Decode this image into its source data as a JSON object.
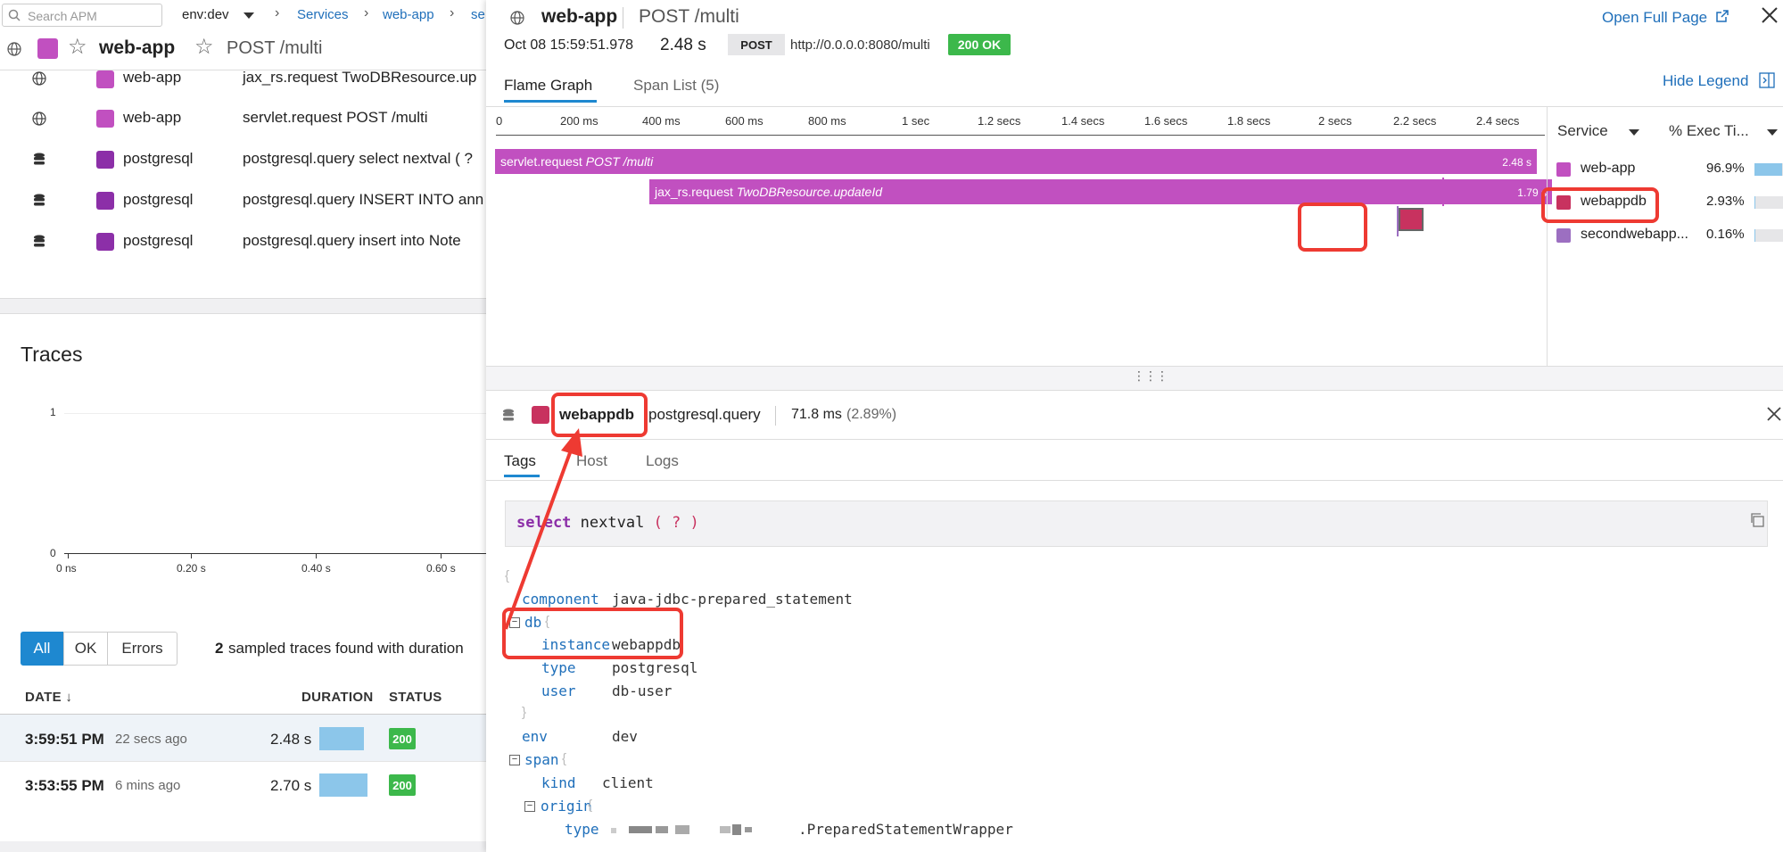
{
  "left": {
    "search_placeholder": "Search APM",
    "env": "env:dev",
    "breadcrumb": [
      "Services",
      "web-app",
      "se"
    ],
    "header": {
      "service": "web-app",
      "resource": "POST /multi"
    },
    "span_rows": [
      {
        "service": "web-app",
        "resource": "jax_rs.request TwoDBResource.up",
        "icon": "globe-icon",
        "color": "#c150c0"
      },
      {
        "service": "web-app",
        "resource": "servlet.request POST /multi",
        "icon": "globe-icon",
        "color": "#c150c0"
      },
      {
        "service": "postgresql",
        "resource": "postgresql.query select nextval ( ?",
        "icon": "database-icon",
        "color": "#8c2fa8"
      },
      {
        "service": "postgresql",
        "resource": "postgresql.query INSERT INTO ann",
        "icon": "database-icon",
        "color": "#8c2fa8"
      },
      {
        "service": "postgresql",
        "resource": "postgresql.query insert into Note",
        "icon": "database-icon",
        "color": "#8c2fa8"
      }
    ],
    "traces": {
      "title": "Traces",
      "y_ticks": [
        "1",
        "0"
      ],
      "x_ticks": [
        "0 ns",
        "0.20 s",
        "0.40 s",
        "0.60 s"
      ],
      "filters": [
        "All",
        "OK",
        "Errors"
      ],
      "summary_count": "2",
      "summary_text": "sampled traces found with duration",
      "columns": [
        "DATE",
        "DURATION",
        "STATUS"
      ],
      "rows": [
        {
          "time": "3:59:51 PM",
          "ago": "22 secs ago",
          "duration": "2.48 s",
          "status": "200"
        },
        {
          "time": "3:53:55 PM",
          "ago": "6 mins ago",
          "duration": "2.70 s",
          "status": "200"
        }
      ]
    }
  },
  "panel": {
    "service": "web-app",
    "resource": "POST /multi",
    "open_full_page": "Open Full Page",
    "timestamp": "Oct 08 15:59:51.978",
    "duration": "2.48 s",
    "method": "POST",
    "url": "http://0.0.0.0:8080/multi",
    "status": "200 OK",
    "tabs": [
      "Flame Graph",
      "Span List (5)"
    ],
    "hide_legend": "Hide Legend",
    "ticks": [
      "0",
      "200 ms",
      "400 ms",
      "600 ms",
      "800 ms",
      "1 sec",
      "1.2 secs",
      "1.4 secs",
      "1.6 secs",
      "1.8 secs",
      "2 secs",
      "2.2 secs",
      "2.4 secs"
    ],
    "flame": [
      {
        "op": "servlet.request",
        "resource": "POST /multi",
        "duration": "2.48 s"
      },
      {
        "op": "jax_rs.request",
        "resource": "TwoDBResource.updateId",
        "duration": "1.79 s"
      }
    ],
    "legend": {
      "col_service": "Service",
      "col_exec": "% Exec Ti...",
      "items": [
        {
          "name": "web-app",
          "pct": "96.9%",
          "fraction": 0.969,
          "color": "#c150c0"
        },
        {
          "name": "webappdb",
          "pct": "2.93%",
          "fraction": 0.0293,
          "color": "#c8325f"
        },
        {
          "name": "secondwebapp...",
          "pct": "0.16%",
          "fraction": 0.0016,
          "color": "#9c6fc1"
        }
      ]
    },
    "span": {
      "service": "webappdb",
      "op": "postgresql.query",
      "duration": "71.8 ms",
      "pct": "(2.89%)",
      "tabs": [
        "Tags",
        "Host",
        "Logs"
      ],
      "query_kw": "select",
      "query_fn": "nextval",
      "query_args": "( ? )",
      "tags": {
        "component_key": "component",
        "component_val": "java-jdbc-prepared_statement",
        "db_key": "db",
        "instance_key": "instance",
        "instance_val": "webappdb",
        "type_key": "type",
        "type_val": "postgresql",
        "user_key": "user",
        "user_val": "db-user",
        "env_key": "env",
        "env_val": "dev",
        "span_key": "span",
        "kind_key": "kind",
        "kind_val": "client",
        "origin_key": "origin",
        "origin_type_key": "type",
        "origin_type_val": ".PreparedStatementWrapper"
      }
    }
  }
}
